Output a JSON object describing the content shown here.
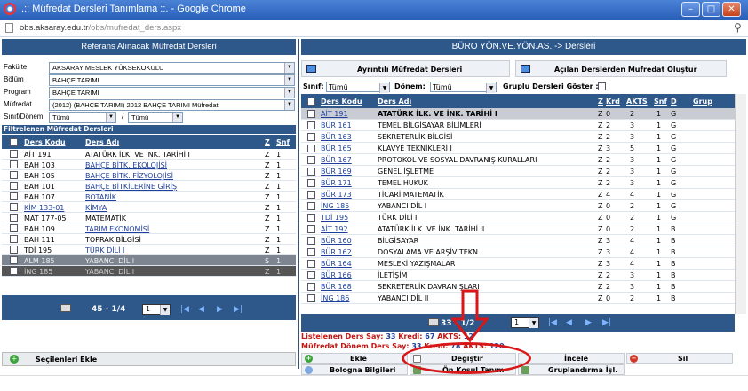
{
  "window": {
    "title": ".:: Müfredat Dersleri Tanımlama ::. - Google Chrome",
    "url_host": "obs.aksaray.edu.tr",
    "url_path": "/obs/mufredat_ders.aspx"
  },
  "left": {
    "header": "Referans Alınacak Müfredat Dersleri",
    "filters": [
      {
        "label": "Fakülte",
        "value": "AKSARAY MESLEK YÜKSEKOKULU"
      },
      {
        "label": "Bölüm",
        "value": "BAHÇE TARIMI"
      },
      {
        "label": "Program",
        "value": "BAHÇE TARIMI"
      },
      {
        "label": "Müfredat",
        "value": "(2012) (BAHÇE TARIMI) 2012 BAHÇE TARIMI Müfredatı"
      }
    ],
    "sinif_label": "Sınıf/Dönem",
    "sinif_value": "Tümü",
    "slash": "/",
    "donem_value": "Tümü",
    "filter_title": "Filtrelenen Müfredat Dersleri",
    "columns": {
      "code": "Ders Kodu",
      "name": "Ders Adı",
      "z": "Z",
      "snf": "Snf"
    },
    "rows": [
      {
        "code": "AİT 191",
        "name": "ATATÜRK İLK. VE İNK. TARİHİ I",
        "z": "Z",
        "snf": "1",
        "link": false
      },
      {
        "code": "BAH 103",
        "name": "BAHÇE BİTK. EKOLOJİSİ",
        "z": "Z",
        "snf": "1",
        "link": true
      },
      {
        "code": "BAH 105",
        "name": "BAHÇE BİTK. FİZYOLOJİSİ",
        "z": "Z",
        "snf": "1",
        "link": true
      },
      {
        "code": "BAH 101",
        "name": "BAHÇE BİTKİLERİNE GİRİŞ",
        "z": "Z",
        "snf": "1",
        "link": true
      },
      {
        "code": "BAH 107",
        "name": "BOTANİK",
        "z": "Z",
        "snf": "1",
        "link": true
      },
      {
        "code": "KİM 133-01",
        "name": "KİMYA",
        "z": "Z",
        "snf": "1",
        "link": true
      },
      {
        "code": "MAT 177-05",
        "name": "MATEMATİK",
        "z": "Z",
        "snf": "1",
        "link": false
      },
      {
        "code": "BAH 109",
        "name": "TARIM EKONOMİSİ",
        "z": "Z",
        "snf": "1",
        "link": true
      },
      {
        "code": "BAH 111",
        "name": "TOPRAK BİLGİSİ",
        "z": "Z",
        "snf": "1",
        "link": false
      },
      {
        "code": "TDİ 195",
        "name": "TÜRK DİLİ I",
        "z": "Z",
        "snf": "1",
        "link": true
      },
      {
        "code": "ALM 185",
        "name": "YABANCI DİL I",
        "z": "S",
        "snf": "1",
        "link": false
      },
      {
        "code": "İNG 185",
        "name": "YABANCI DİL I",
        "z": "Z",
        "snf": "1",
        "link": false
      }
    ],
    "pager_text": "45 - 1/4",
    "pager_page": "1",
    "selected_add_label": "Seçilenleri Ekle"
  },
  "right": {
    "header": "BÜRO YÖN.VE.YÖN.AS. -> Dersleri",
    "btn_detail": "Ayrıntılı Müfredat Dersleri",
    "btn_create": "Açılan Derslerden Mufredat Oluştur",
    "f_sinif_label": "Sınıf:",
    "f_sinif_value": "Tümü",
    "f_donem_label": "Dönem:",
    "f_donem_value": "Tümü",
    "f_grup_label": "Gruplu Dersleri Göster :",
    "columns": {
      "code": "Ders Kodu",
      "name": "Ders Adı",
      "z": "Z",
      "krd": "Krd",
      "akts": "AKTS",
      "snf": "Snf",
      "d": "D",
      "grup": "Grup"
    },
    "rows": [
      {
        "code": "AİT 191",
        "name": "ATATÜRK İLK. VE İNK. TARİHİ I",
        "z": "Z",
        "krd": "0",
        "akts": "2",
        "snf": "1",
        "d": "G",
        "bold": true
      },
      {
        "code": "BÜR 161",
        "name": "TEMEL BİLGİSAYAR BİLİMLERİ",
        "z": "Z",
        "krd": "2",
        "akts": "3",
        "snf": "1",
        "d": "G",
        "bold": false
      },
      {
        "code": "BÜR 163",
        "name": "SEKRETERLİK BİLGİSİ",
        "z": "Z",
        "krd": "2",
        "akts": "3",
        "snf": "1",
        "d": "G",
        "bold": false
      },
      {
        "code": "BÜR 165",
        "name": "KLAVYE TEKNİKLERİ I",
        "z": "Z",
        "krd": "3",
        "akts": "5",
        "snf": "1",
        "d": "G",
        "bold": false
      },
      {
        "code": "BÜR 167",
        "name": "PROTOKOL VE SOSYAL DAVRANIŞ KURALLARI",
        "z": "Z",
        "krd": "2",
        "akts": "3",
        "snf": "1",
        "d": "G",
        "bold": false
      },
      {
        "code": "BÜR 169",
        "name": "GENEL İŞLETME",
        "z": "Z",
        "krd": "2",
        "akts": "3",
        "snf": "1",
        "d": "G",
        "bold": false
      },
      {
        "code": "BÜR 171",
        "name": "TEMEL HUKUK",
        "z": "Z",
        "krd": "2",
        "akts": "3",
        "snf": "1",
        "d": "G",
        "bold": false
      },
      {
        "code": "BÜR 173",
        "name": "TİCARİ MATEMATİK",
        "z": "Z",
        "krd": "4",
        "akts": "4",
        "snf": "1",
        "d": "G",
        "bold": false
      },
      {
        "code": "İNG 185",
        "name": "YABANCI DİL I",
        "z": "Z",
        "krd": "0",
        "akts": "2",
        "snf": "1",
        "d": "G",
        "bold": false
      },
      {
        "code": "TDİ 195",
        "name": "TÜRK DİLİ I",
        "z": "Z",
        "krd": "0",
        "akts": "2",
        "snf": "1",
        "d": "G",
        "bold": false
      },
      {
        "code": "AİT 192",
        "name": "ATATÜRK İLK. VE İNK. TARİHİ II",
        "z": "Z",
        "krd": "0",
        "akts": "2",
        "snf": "1",
        "d": "B",
        "bold": false
      },
      {
        "code": "BÜR 160",
        "name": "BİLGİSAYAR",
        "z": "Z",
        "krd": "3",
        "akts": "4",
        "snf": "1",
        "d": "B",
        "bold": false
      },
      {
        "code": "BÜR 162",
        "name": "DOSYALAMA VE ARŞİV TEKN.",
        "z": "Z",
        "krd": "3",
        "akts": "4",
        "snf": "1",
        "d": "B",
        "bold": false
      },
      {
        "code": "BÜR 164",
        "name": "MESLEKİ YAZIŞMALAR",
        "z": "Z",
        "krd": "3",
        "akts": "4",
        "snf": "1",
        "d": "B",
        "bold": false
      },
      {
        "code": "BÜR 166",
        "name": "İLETİŞİM",
        "z": "Z",
        "krd": "2",
        "akts": "3",
        "snf": "1",
        "d": "B",
        "bold": false
      },
      {
        "code": "BÜR 168",
        "name": "SEKRETERLİK DAVRANIŞLARI",
        "z": "Z",
        "krd": "2",
        "akts": "3",
        "snf": "1",
        "d": "B",
        "bold": false
      },
      {
        "code": "İNG 186",
        "name": "YABANCI DİL II",
        "z": "Z",
        "krd": "0",
        "akts": "2",
        "snf": "1",
        "d": "B",
        "bold": false
      }
    ],
    "pager_text": "33 - 1/2",
    "pager_page": "1",
    "stat1": {
      "label": "Listelenen Ders Say:",
      "count": "33",
      "kredi_label": "Kredi:",
      "kredi": "67",
      "akts_label": "AKTS:",
      "akts": "12"
    },
    "stat2": {
      "label": "Müfredat Dönem Ders Say:",
      "count": "33",
      "kredi_label": "Kredi:",
      "kredi": "78",
      "akts_label": "AKTS:",
      "akts": "120"
    },
    "actions": {
      "add": "Ekle",
      "change": "Değiştir",
      "review": "İncele",
      "delete": "Sil",
      "bologna": "Bologna Bilgileri",
      "grade": "Ön Koşul Tanım",
      "group": "Gruplandırma İşl."
    }
  }
}
